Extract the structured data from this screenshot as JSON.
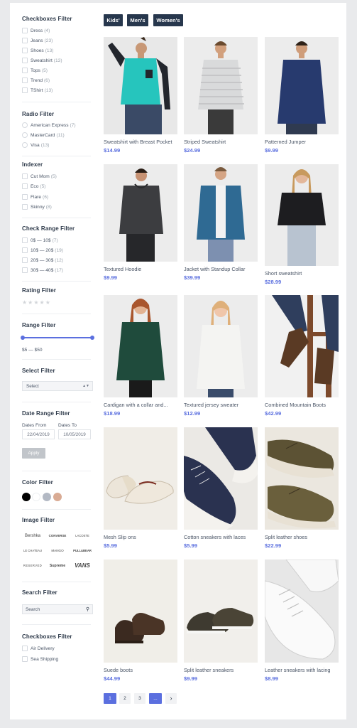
{
  "tags": [
    "Kids'",
    "Men's",
    "Women's"
  ],
  "filters": {
    "checkboxes": {
      "title": "Checkboxes Filter",
      "items": [
        {
          "label": "Dress",
          "count": "(4)"
        },
        {
          "label": "Jeans",
          "count": "(23)"
        },
        {
          "label": "Shoes",
          "count": "(13)"
        },
        {
          "label": "Sweatshirt",
          "count": "(13)"
        },
        {
          "label": "Tops",
          "count": "(5)"
        },
        {
          "label": "Trend",
          "count": "(6)"
        },
        {
          "label": "TShirt",
          "count": "(13)"
        }
      ]
    },
    "radio": {
      "title": "Radio Filter",
      "items": [
        {
          "label": "American Express",
          "count": "(7)"
        },
        {
          "label": "MasterCard",
          "count": "(11)"
        },
        {
          "label": "Visa",
          "count": "(13)"
        }
      ]
    },
    "indexer": {
      "title": "Indexer",
      "items": [
        {
          "label": "Cut Mom",
          "count": "(5)"
        },
        {
          "label": "Eco",
          "count": "(5)"
        },
        {
          "label": "Flare",
          "count": "(6)"
        },
        {
          "label": "Skinny",
          "count": "(8)"
        }
      ]
    },
    "check_range": {
      "title": "Check Range Filter",
      "items": [
        {
          "label": "0$ — 10$",
          "count": "(7)"
        },
        {
          "label": "10$ — 20$",
          "count": "(19)"
        },
        {
          "label": "20$ — 30$",
          "count": "(12)"
        },
        {
          "label": "30$ — 40$",
          "count": "(17)"
        }
      ]
    },
    "rating": {
      "title": "Rating Filter",
      "stars": "★★★★★"
    },
    "range": {
      "title": "Range Filter",
      "value": "$5 — $50"
    },
    "select": {
      "title": "Select Filter",
      "value": "Select",
      "caret": "▲▼"
    },
    "date_range": {
      "title": "Date Range Filter",
      "from_label": "Dates From",
      "to_label": "Dates To",
      "from_value": "22/04/2019",
      "to_value": "10/05/2019",
      "apply": "Apply"
    },
    "color": {
      "title": "Color Filter",
      "swatches": [
        "#000000",
        "#ffffff",
        "#b3b9c4",
        "#d9ab94"
      ]
    },
    "image": {
      "title": "Image Filter",
      "brands": [
        "Bershka",
        "CONVERSE",
        "LACOSTE",
        "LE CHATEAU",
        "MANGO",
        "PULL&BEAR",
        "RESERVED",
        "Supreme",
        "VANS"
      ]
    },
    "search": {
      "title": "Search Filter",
      "placeholder": "Search"
    },
    "checkboxes2": {
      "title": "Checkboxes Filter",
      "items": [
        {
          "label": "Air Delivery"
        },
        {
          "label": "Sea Shipping"
        }
      ]
    }
  },
  "products": [
    {
      "name": "Sweatshirt with Breast Pocket",
      "price": "$14.99",
      "icon": "teal-sweatshirt-image"
    },
    {
      "name": "Striped Sweatshirt",
      "price": "$24.99",
      "icon": "striped-sweatshirt-image"
    },
    {
      "name": "Patterned Jumper",
      "price": "$9.99",
      "icon": "navy-jumper-image"
    },
    {
      "name": "Textured Hoodie",
      "price": "$9.99",
      "icon": "grey-hoodie-image"
    },
    {
      "name": "Jacket with Standup Collar",
      "price": "$39.99",
      "icon": "blue-jacket-image"
    },
    {
      "name": "Short sweatshirt",
      "price": "$28.99",
      "icon": "black-sweatshirt-image"
    },
    {
      "name": "Cardigan with a collar and...",
      "price": "$18.99",
      "icon": "green-cardigan-image"
    },
    {
      "name": "Textured jersey sweater",
      "price": "$12.99",
      "icon": "white-sweater-image"
    },
    {
      "name": "Combined Mountain Boots",
      "price": "$42.99",
      "icon": "brown-boots-image"
    },
    {
      "name": "Mesh Slip ons",
      "price": "$5.99",
      "icon": "slip-ons-image"
    },
    {
      "name": "Cotton sneakers with laces",
      "price": "$5.99",
      "icon": "navy-sneakers-image"
    },
    {
      "name": "Split leather shoes",
      "price": "$22.99",
      "icon": "olive-shoes-image"
    },
    {
      "name": "Suede boots",
      "price": "$44.99",
      "icon": "suede-boots-image"
    },
    {
      "name": "Split leather sneakers",
      "price": "$9.99",
      "icon": "leather-sneakers-image"
    },
    {
      "name": "Leather sneakers with lacing",
      "price": "$8.99",
      "icon": "white-sneakers-image"
    }
  ],
  "pagination": {
    "pages": [
      "1",
      "2",
      "3",
      "..."
    ],
    "next": "›"
  },
  "colors": {
    "accent": "#5b6fdf",
    "tag_bg": "#27374d"
  }
}
